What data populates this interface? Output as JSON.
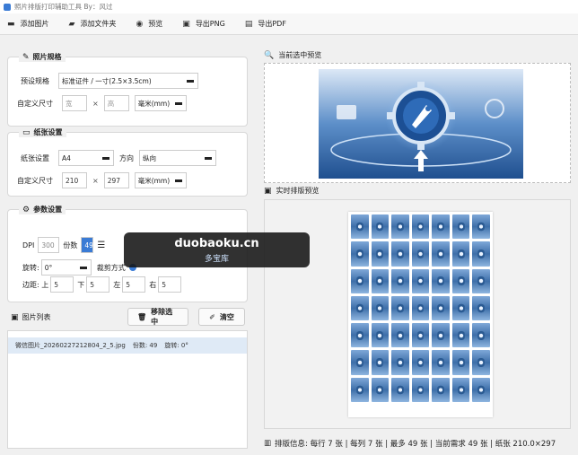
{
  "window": {
    "title": "照片排版打印辅助工具 By：风过"
  },
  "toolbar": {
    "add_image": "添加图片",
    "add_folder": "添加文件夹",
    "preview": "预览",
    "export_png": "导出PNG",
    "export_pdf": "导出PDF"
  },
  "photo_spec": {
    "title": "照片规格",
    "preset_label": "预设规格",
    "preset_value": "标准证件 / 一寸(2.5×3.5cm)",
    "custom_label": "自定义尺寸",
    "width_placeholder": "宽",
    "height_placeholder": "高",
    "unit": "毫米(mm)"
  },
  "paper": {
    "title": "纸张设置",
    "paper_label": "纸张设置",
    "paper_value": "A4",
    "orientation_label": "方向",
    "orientation_value": "纵向",
    "custom_label": "自定义尺寸",
    "width": "210",
    "height": "297",
    "unit": "毫米(mm)"
  },
  "params": {
    "title": "参数设置",
    "dpi_label": "DPI",
    "dpi_value": "300",
    "copies_label": "份数",
    "copies_value": "49",
    "rotation_label": "旋转:",
    "rotation_value": "0°",
    "crop_label": "裁剪方式",
    "margin_label": "边距: 上",
    "margin_top": "5",
    "margin_bottom_label": "下",
    "margin_bottom": "5",
    "margin_left_label": "左",
    "margin_left": "5",
    "margin_right_label": "右",
    "margin_right": "5"
  },
  "image_list": {
    "title": "图片列表",
    "remove_selected": "移除选中",
    "clear": "清空",
    "items": [
      {
        "filename": "微信图片_20260227212804_2_5.jpg",
        "copies": "份数: 49",
        "rotation": "旋转: 0°"
      }
    ]
  },
  "right_panel": {
    "current_preview_title": "当前选中预览",
    "layout_preview_title": "实时排版预览",
    "layout_grid": {
      "rows": 7,
      "cols": 7
    }
  },
  "status": {
    "text": "排版信息: 每行 7 张 | 每列 7 张 | 最多 49 张 | 当前需求 49 张 | 纸张 210.0×297"
  },
  "watermark": {
    "main": "duobaoku.cn",
    "sub": "多宝库"
  },
  "colors": {
    "accent": "#3a7bd5",
    "list_selected": "#dfeaf6",
    "overlay": "#141414"
  }
}
